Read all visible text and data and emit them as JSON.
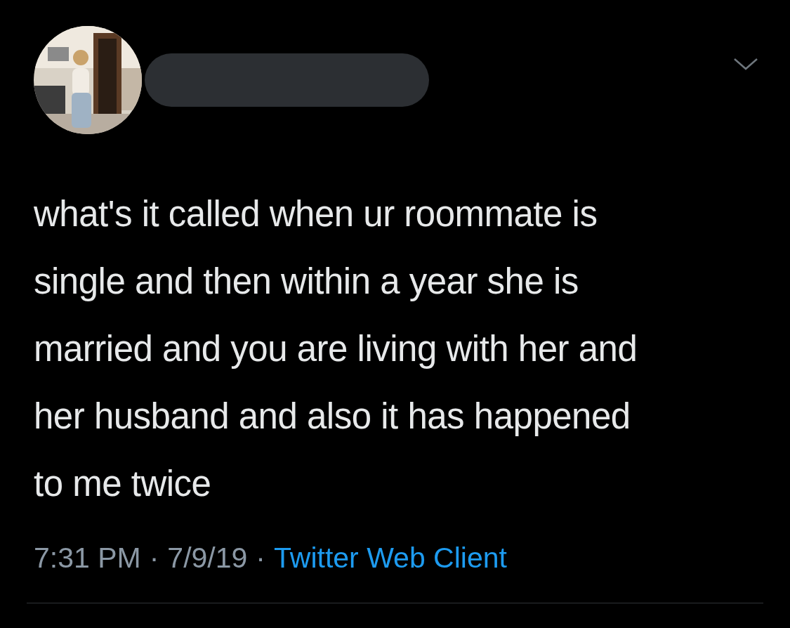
{
  "author": {
    "name_redacted": true
  },
  "tweet": {
    "lines": [
      "what's it called when ur roommate is",
      "single and then within a year she is",
      "married and you are living with her and",
      "her husband and also it has happened",
      "to me twice"
    ]
  },
  "meta": [
    {
      "kind": "text",
      "text": "7:31 PM"
    },
    {
      "kind": "separator",
      "text": "·"
    },
    {
      "kind": "text",
      "text": "7/9/19"
    },
    {
      "kind": "separator",
      "text": "·"
    },
    {
      "kind": "link",
      "text": "Twitter Web Client"
    }
  ]
}
